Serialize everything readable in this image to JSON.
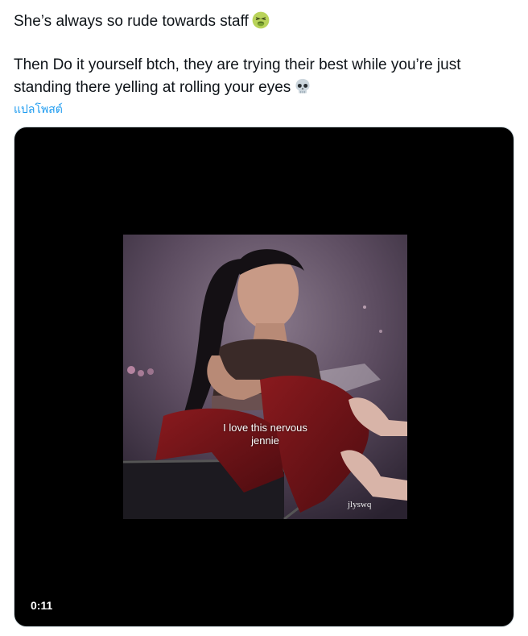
{
  "tweet": {
    "line1": "She’s always so rude towards staff",
    "line1_emoji": "nauseated-face-icon",
    "line2": "Then Do it yourself btch, they are trying their best while you’re just standing there yelling at rolling your eyes",
    "line2_emoji": "skull-icon",
    "translate_label": "แปลโพสต์"
  },
  "media": {
    "caption_line1": "I love this nervous",
    "caption_line2": "jennie",
    "watermark": "jlyswq",
    "duration": "0:11"
  },
  "colors": {
    "link": "#1d9bf0",
    "text": "#0f1419",
    "media_bg": "#000000"
  }
}
